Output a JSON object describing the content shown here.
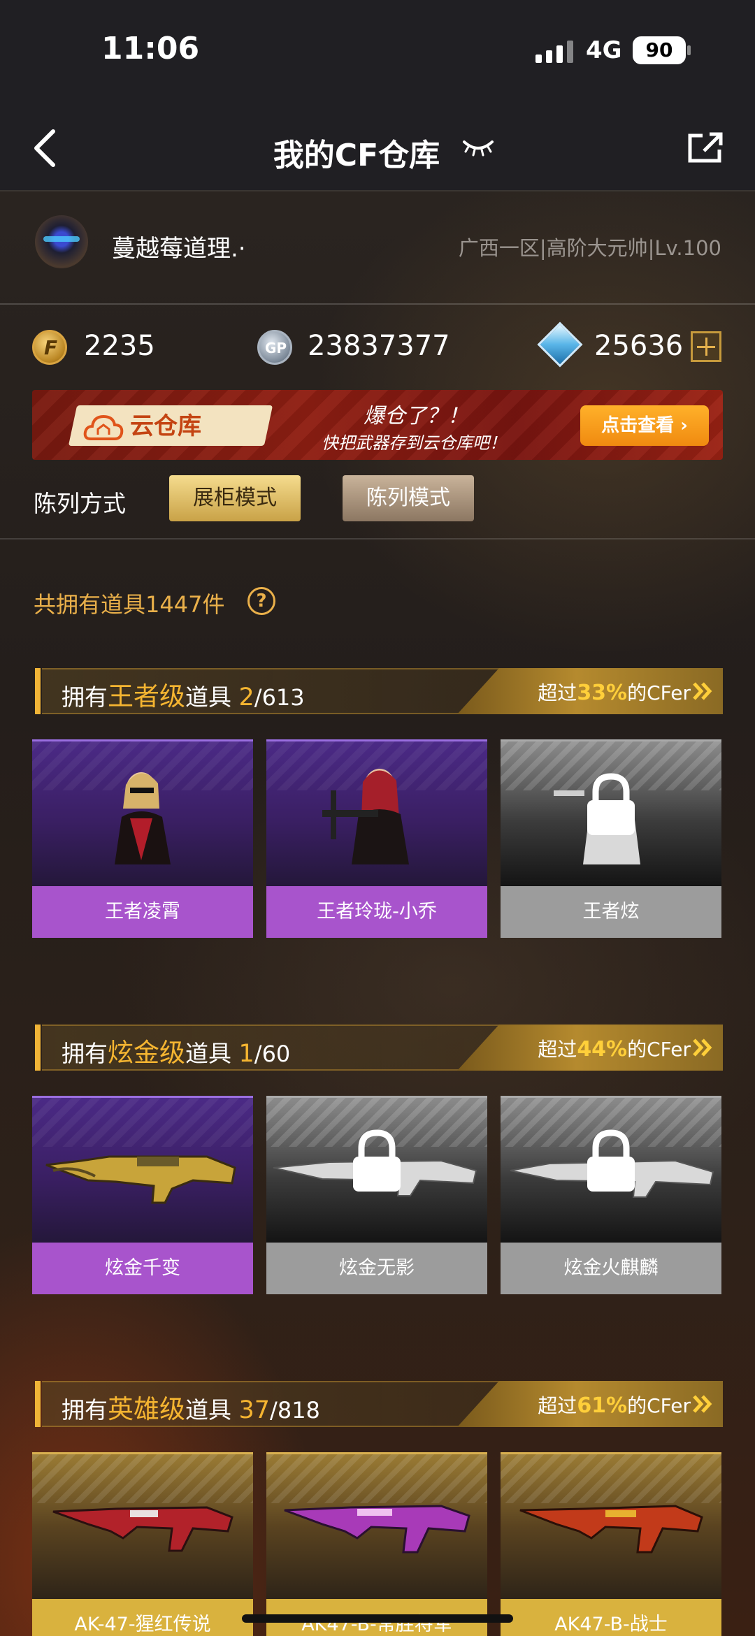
{
  "status": {
    "time": "11:06",
    "network": "4G",
    "battery": "90"
  },
  "nav": {
    "title": "我的CF仓库"
  },
  "user": {
    "name": "蔓越莓道理.·",
    "server": "广西一区|高阶大元帅|Lv.100"
  },
  "currency": {
    "cf_points": "2235",
    "gp": "23837377",
    "diamonds": "25636"
  },
  "banner": {
    "brand": "云仓库",
    "line1": "爆仓了？！",
    "line2": "快把武器存到云仓库吧！",
    "button": "点击查看 ›"
  },
  "display": {
    "label": "陈列方式",
    "mode_showcase": "展柜模式",
    "mode_display": "陈列模式"
  },
  "summary": {
    "total": "共拥有道具1447件"
  },
  "sections": [
    {
      "prefix": "拥有",
      "grade": "王者级",
      "suffix": "道具",
      "owned": "2",
      "total": "/613",
      "rank_pre": "超过",
      "rank_pct": "33%",
      "rank_post": "的CFer",
      "items": [
        {
          "name": "王者凌霄",
          "owned": true
        },
        {
          "name": "王者玲珑-小乔",
          "owned": true
        },
        {
          "name": "王者炫",
          "owned": false
        }
      ]
    },
    {
      "prefix": "拥有",
      "grade": "炫金级",
      "suffix": "道具",
      "owned": "1",
      "total": "/60",
      "rank_pre": "超过",
      "rank_pct": "44%",
      "rank_post": "的CFer",
      "items": [
        {
          "name": "炫金千变",
          "owned": true
        },
        {
          "name": "炫金无影",
          "owned": false
        },
        {
          "name": "炫金火麒麟",
          "owned": false
        }
      ]
    },
    {
      "prefix": "拥有",
      "grade": "英雄级",
      "suffix": "道具",
      "owned": "37",
      "total": "/818",
      "rank_pre": "超过",
      "rank_pct": "61%",
      "rank_post": "的CFer",
      "items": [
        {
          "name": "AK-47-猩红传说",
          "owned": true
        },
        {
          "name": "AK47-B-常胜将军",
          "owned": true
        },
        {
          "name": "AK47-B-战士",
          "owned": true
        }
      ]
    }
  ],
  "colors": {
    "accent_gold": "#f5b531",
    "king_purple": "#a854cc",
    "hero_gold": "#d9b23e",
    "locked_gray": "#9c9c9c"
  }
}
